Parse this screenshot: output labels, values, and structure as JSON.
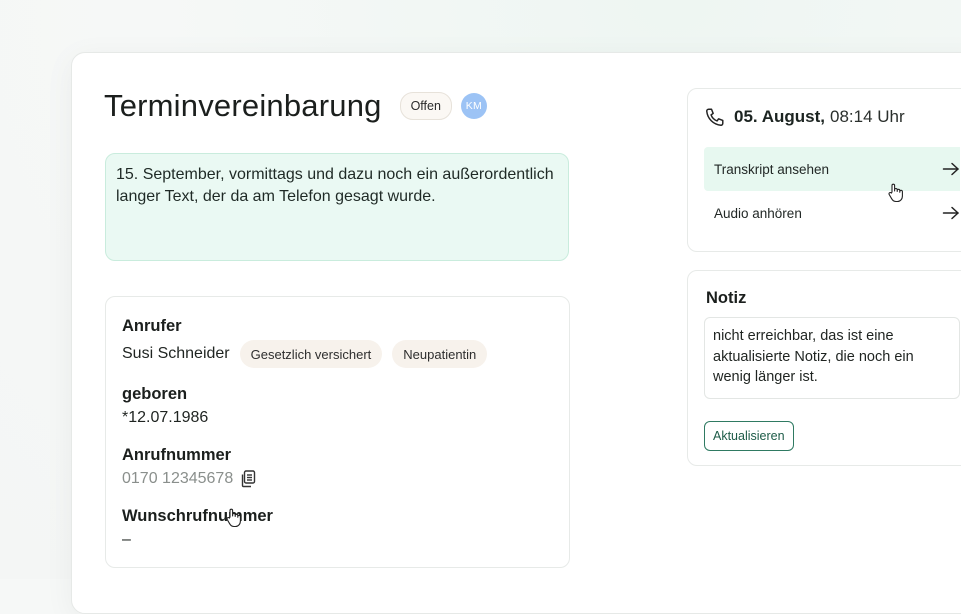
{
  "header": {
    "title": "Terminvereinbarung",
    "status": "Offen",
    "avatar_initials": "KM"
  },
  "summary": {
    "text": "15. September, vormittags und dazu noch ein außerordentlich langer Text, der da am Telefon gesagt wurde."
  },
  "caller": {
    "label": "Anrufer",
    "name": "Susi Schneider",
    "tags": [
      "Gesetzlich versichert",
      "Neupatientin"
    ],
    "birth_label": "geboren",
    "birth_value": "*12.07.1986",
    "phone_label": "Anrufnummer",
    "phone_value": "0170 12345678",
    "callback_label": "Wunschrufnummer",
    "callback_value": "–"
  },
  "call": {
    "date": "05. August,",
    "time": "08:14 Uhr",
    "actions": [
      {
        "label": "Transkript ansehen"
      },
      {
        "label": "Audio anhören"
      }
    ]
  },
  "note": {
    "title": "Notiz",
    "text": "nicht erreichbar, das ist eine aktualisierte Notiz, die noch ein wenig länger ist.",
    "button_label": "Aktualisieren"
  },
  "icons": {
    "phone": "phone-icon",
    "arrow": "arrow-right-icon",
    "copy": "copy-icon",
    "cursor": "hand-pointer-icon"
  },
  "colors": {
    "accent": "#2f7a62",
    "summary_bg": "#eaf9f3",
    "avatar": "#9cc3f5"
  }
}
